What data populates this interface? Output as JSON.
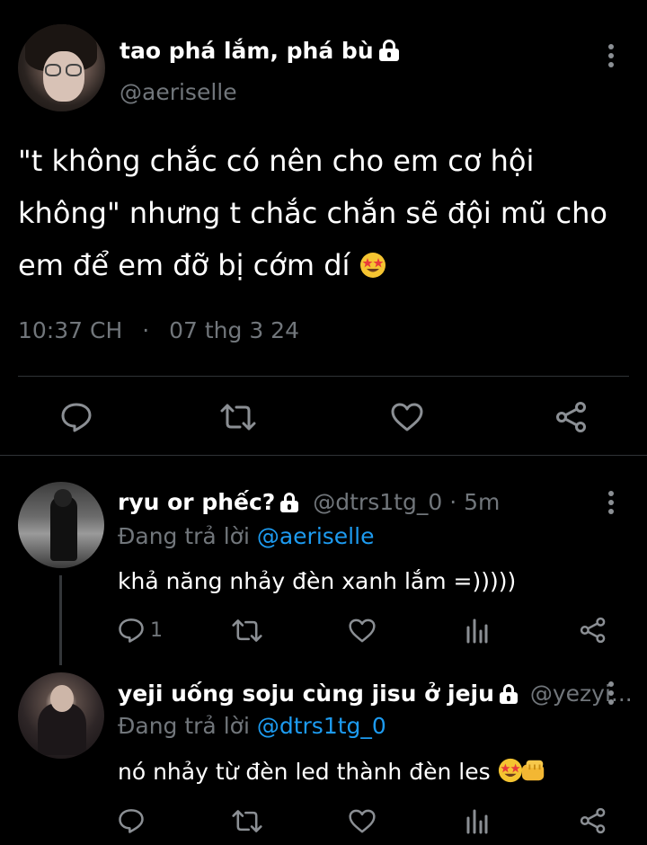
{
  "main_tweet": {
    "display_name": "tao phá lắm, phá bù",
    "handle": "@aeriselle",
    "text": "\"t không chắc có nên cho em cơ hội không\" nhưng t chắc chắn sẽ đội mũ cho em để em đỡ bị cớm dí",
    "time": "10:37 CH",
    "separator": "·",
    "date": "07 thg 3 24",
    "emoji": "star-struck-emoji",
    "actions": [
      "reply-icon",
      "retweet-icon",
      "like-icon",
      "share-icon"
    ]
  },
  "replies": [
    {
      "display_name": "ryu or phếc?",
      "handle": "@dtrs1tg_0",
      "separator": "·",
      "time": "5m",
      "replying_prefix": "Đang trả lời",
      "replying_to": "@aeriselle",
      "text": "khả năng nhảy đèn xanh lắm =)))))",
      "reply_count": "1"
    },
    {
      "display_name": "yeji uống soju cùng jisu ở jeju",
      "handle": "@yezyi...",
      "replying_prefix": "Đang trả lời",
      "replying_to": "@dtrs1tg_0",
      "text": "nó nhảy từ đèn led thành đèn les",
      "emojis": [
        "star-struck-emoji",
        "fist-bump-emoji"
      ]
    }
  ],
  "colors": {
    "background": "#000000",
    "text": "#e7e9ea",
    "muted": "#71767b",
    "link": "#1d9bf0",
    "divider": "#2f3336"
  }
}
